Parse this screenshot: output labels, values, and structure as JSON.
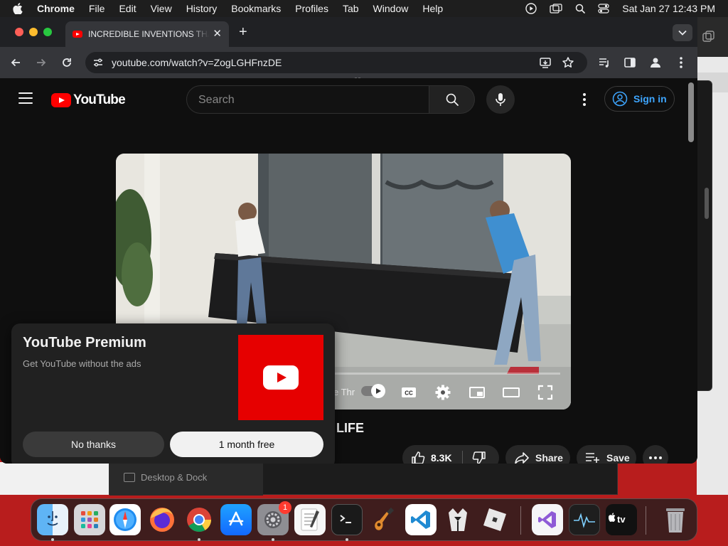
{
  "menubar": {
    "app_name": "Chrome",
    "menus": [
      "File",
      "Edit",
      "View",
      "History",
      "Bookmarks",
      "Profiles",
      "Tab",
      "Window",
      "Help"
    ],
    "datetime": "Sat Jan 27  12:43 PM"
  },
  "browser": {
    "tab_title": "INCREDIBLE INVENTIONS THAT WILL MAKE YOUR LIFE",
    "url": "youtube.com/watch?v=ZogLGHFnzDE"
  },
  "youtube": {
    "logo_text": "YouTube",
    "search_placeholder": "Search",
    "sign_in_label": "Sign in",
    "video_title_fragment": "LIFE",
    "player": {
      "autoplay_text": "e Thr"
    },
    "actions": {
      "like_count": "8.3K",
      "share_label": "Share",
      "save_label": "Save"
    }
  },
  "premium_promo": {
    "title": "YouTube Premium",
    "subtitle": "Get YouTube without the ads",
    "dismiss_label": "No thanks",
    "accept_label": "1 month free"
  },
  "background": {
    "settings_item": "Desktop & Dock"
  },
  "dock": {
    "apps": [
      "Finder",
      "Launchpad",
      "Safari",
      "Firefox",
      "Chrome",
      "App Store",
      "System Settings",
      "TextEdit",
      "Terminal",
      "GarageBand",
      "Visual Studio Code",
      "Bartender",
      "Roblox",
      "Visual Studio",
      "Activity Monitor",
      "Apple TV",
      "Trash"
    ],
    "system_settings_badge": "1"
  },
  "colors": {
    "youtube_red": "#ff0000",
    "link_blue": "#3ea6ff",
    "desktop_red": "#b81d1d"
  }
}
